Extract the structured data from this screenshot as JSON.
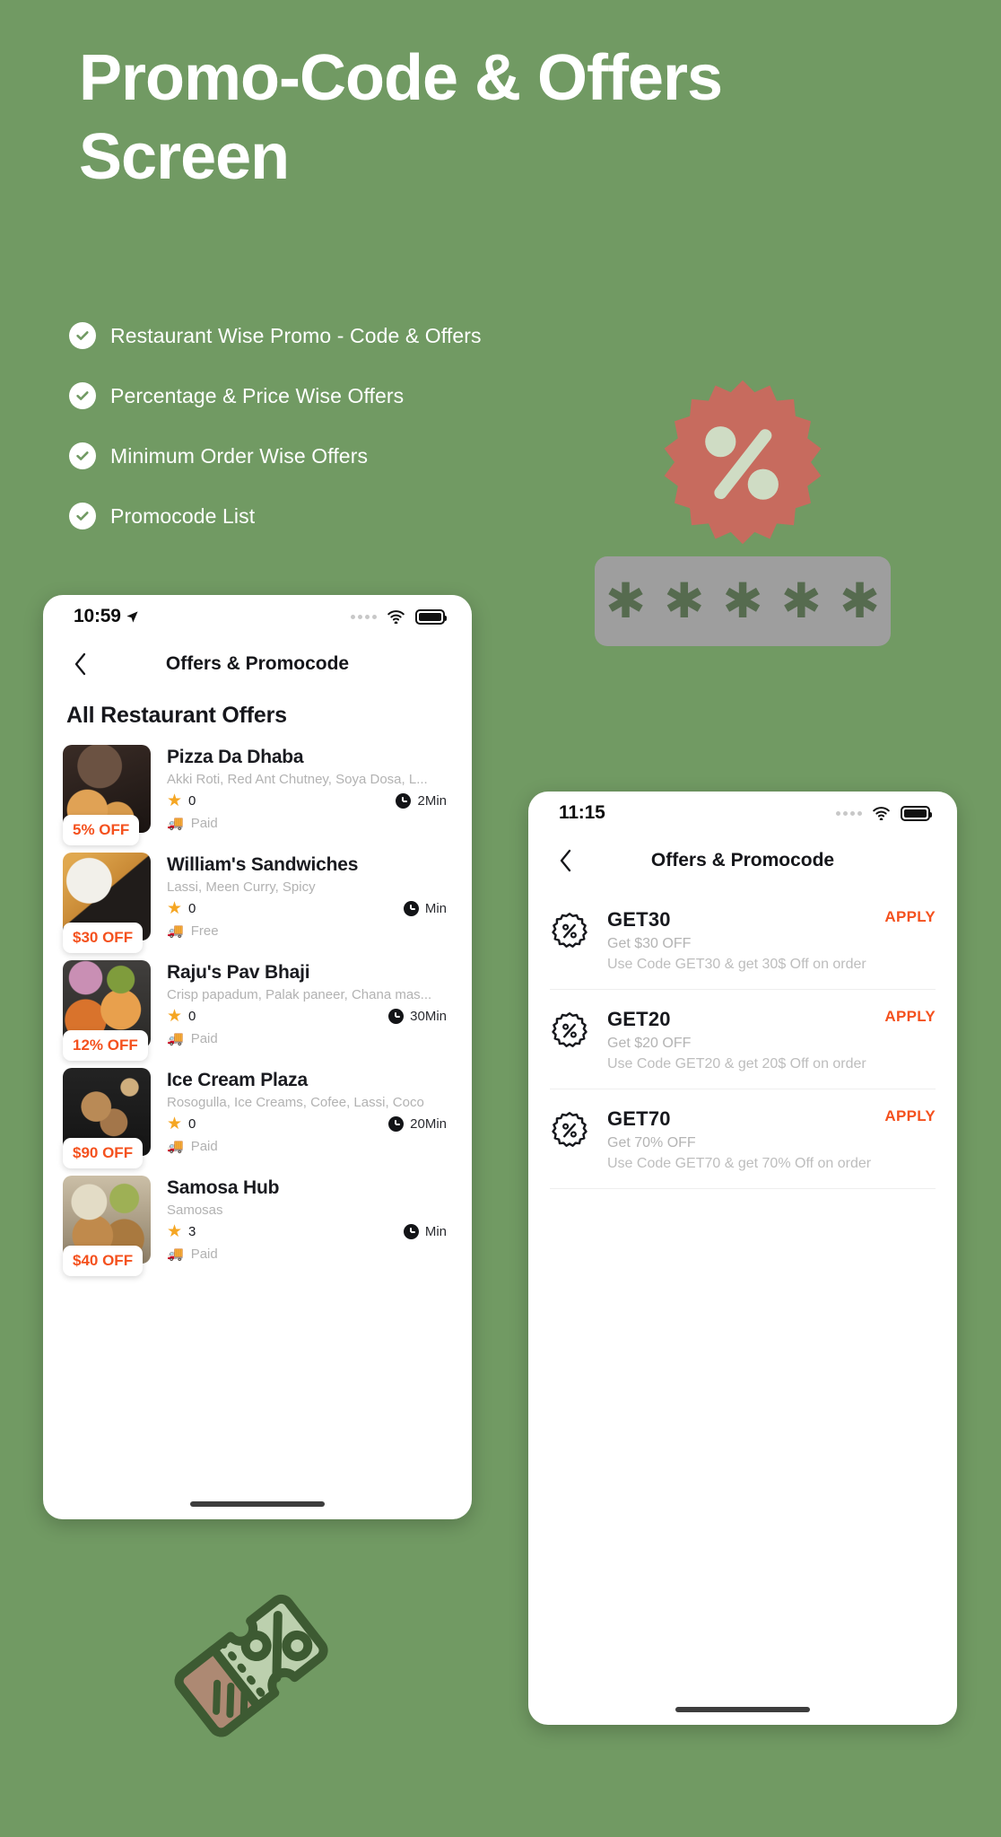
{
  "page": {
    "background_color": "#719a63",
    "headline": "Promo-Code & Offers Screen"
  },
  "features": {
    "items": [
      {
        "icon": "check-circle-icon",
        "label": "Restaurant Wise Promo - Code & Offers"
      },
      {
        "icon": "check-circle-icon",
        "label": "Percentage & Price Wise Offers"
      },
      {
        "icon": "check-circle-icon",
        "label": "Minimum Order Wise Offers"
      },
      {
        "icon": "check-circle-icon",
        "label": "Promocode List"
      }
    ]
  },
  "decorations": {
    "percent_badge": {
      "icon": "percent-badge-icon",
      "color": "#c76b5e",
      "glyph_color": "#cfdcc4"
    },
    "asterisk_bar": {
      "icon": "password-asterisks-icon",
      "color": "#9e9e9e",
      "glyph": "✱",
      "count": 5
    },
    "coupon_ticket": {
      "icon": "coupon-ticket-icon",
      "color": "#3d5a32",
      "fill": "#bcd0ae",
      "stub_fill": "#ad8973"
    }
  },
  "phone_one": {
    "status_bar": {
      "time": "10:59",
      "location_icon": "location-arrow-icon",
      "signal_icon": "signal-dots-icon",
      "wifi_icon": "wifi-icon",
      "battery_icon": "battery-full-icon"
    },
    "nav": {
      "back_icon": "chevron-left-icon",
      "title": "Offers & Promocode"
    },
    "section_title": "All Restaurant Offers",
    "restaurants": [
      {
        "name": "Pizza Da Dhaba",
        "description": "Akki Roti, Red Ant Chutney, Soya Dosa, L...",
        "rating": "0",
        "time": "2Min",
        "delivery": "Paid",
        "offer": "5% OFF",
        "thumb_class": "th-a"
      },
      {
        "name": "William's Sandwiches",
        "description": "Lassi, Meen Curry, Spicy",
        "rating": "0",
        "time": "Min",
        "delivery": "Free",
        "offer": "$30 OFF",
        "thumb_class": "th-b"
      },
      {
        "name": "Raju's Pav Bhaji",
        "description": "Crisp papadum, Palak paneer, Chana mas...",
        "rating": "0",
        "time": "30Min",
        "delivery": "Paid",
        "offer": "12% OFF",
        "thumb_class": "th-c"
      },
      {
        "name": "Ice Cream Plaza",
        "description": "Rosogulla, Ice Creams, Cofee, Lassi, Coco",
        "rating": "0",
        "time": "20Min",
        "delivery": "Paid",
        "offer": "$90 OFF",
        "thumb_class": "th-d"
      },
      {
        "name": "Samosa Hub",
        "description": "Samosas",
        "rating": "3",
        "time": "Min",
        "delivery": "Paid",
        "offer": "$40 OFF",
        "thumb_class": "th-e"
      }
    ]
  },
  "phone_two": {
    "status_bar": {
      "time": "11:15",
      "signal_icon": "signal-dots-icon",
      "wifi_icon": "wifi-icon",
      "battery_icon": "battery-full-icon"
    },
    "nav": {
      "back_icon": "chevron-left-icon",
      "title": "Offers & Promocode"
    },
    "promos": [
      {
        "icon": "percent-seal-icon",
        "code": "GET30",
        "subtitle": "Get $30 OFF",
        "description": "Use Code GET30 & get 30$ Off on order",
        "apply_label": "APPLY"
      },
      {
        "icon": "percent-seal-icon",
        "code": "GET20",
        "subtitle": "Get $20 OFF",
        "description": "Use Code GET20 & get 20$ Off on order",
        "apply_label": "APPLY"
      },
      {
        "icon": "percent-seal-icon",
        "code": "GET70",
        "subtitle": "Get 70% OFF",
        "description": "Use Code GET70 & get 70% Off on order",
        "apply_label": "APPLY"
      }
    ]
  },
  "colors": {
    "accent_orange": "#f4511e",
    "star_yellow": "#f5a623",
    "muted_gray": "#b2b2b2"
  }
}
